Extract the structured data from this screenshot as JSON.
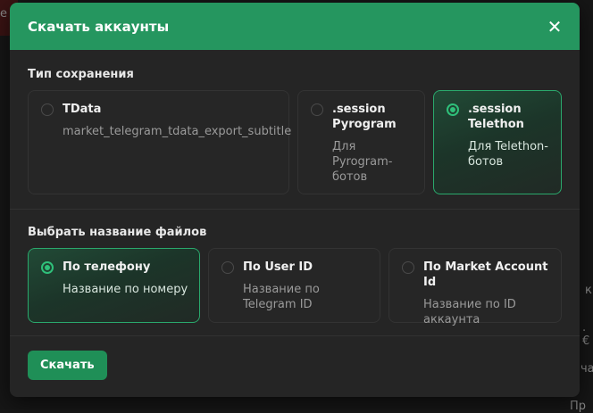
{
  "background": {
    "fragments": [
      "е",
      "к",
      ".€",
      "ча",
      "Пр"
    ]
  },
  "modal": {
    "title": "Скачать аккаунты",
    "close_icon": "close-icon"
  },
  "save_type": {
    "label": "Тип сохранения",
    "options": [
      {
        "title": "TData",
        "subtitle": "market_telegram_tdata_export_subtitle",
        "selected": false
      },
      {
        "title": ".session Pyrogram",
        "subtitle": "Для Pyrogram-ботов",
        "selected": false
      },
      {
        "title": ".session Telethon",
        "subtitle": "Для Telethon-ботов",
        "selected": true
      }
    ]
  },
  "file_name": {
    "label": "Выбрать название файлов",
    "options": [
      {
        "title": "По телефону",
        "subtitle": "Название по номеру",
        "selected": true
      },
      {
        "title": "По User ID",
        "subtitle": "Название по Telegram ID",
        "selected": false
      },
      {
        "title": "По Market Account Id",
        "subtitle": "Название по ID аккаунта",
        "selected": false
      }
    ]
  },
  "footer": {
    "download_label": "Скачать"
  },
  "colors": {
    "accent": "#25965f",
    "accent_bright": "#2fc07a",
    "modal_bg": "#252525"
  }
}
